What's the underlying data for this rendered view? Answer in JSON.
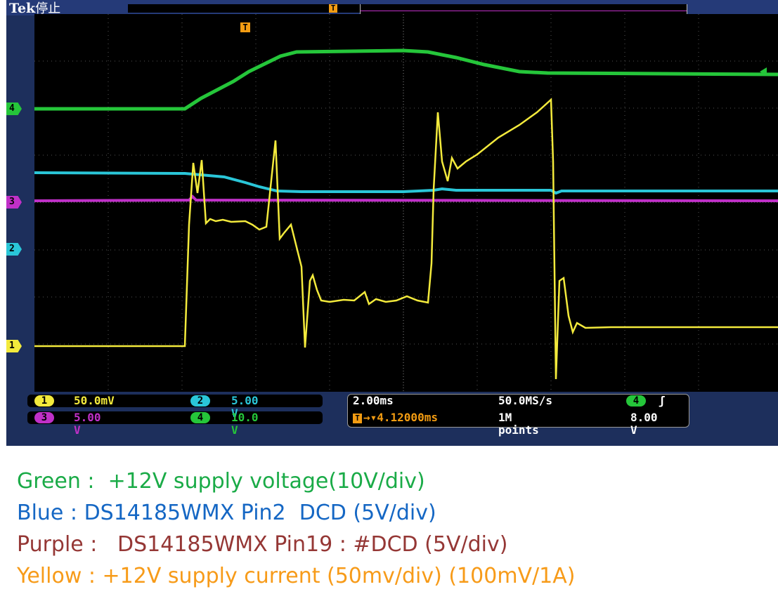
{
  "scope": {
    "brand": "Tek",
    "run_state": "停止",
    "trigger_marker": "T",
    "channel_markers": [
      "4",
      "3",
      "2",
      "1"
    ]
  },
  "channels": {
    "ch1": {
      "number": "1",
      "scale": "50.0mV",
      "color": "#f3ea3c"
    },
    "ch2": {
      "number": "2",
      "scale": "5.00 V",
      "color": "#2ac6d8"
    },
    "ch3": {
      "number": "3",
      "scale": "5.00 V",
      "color": "#c030c8"
    },
    "ch4": {
      "number": "4",
      "scale": "10.0 V",
      "color": "#25c63a"
    }
  },
  "timebase": {
    "time_div": "2.00ms",
    "sample_rate": "50.0MS/s",
    "trigger_delay": "4.12000ms",
    "record_length": "1M points"
  },
  "trigger": {
    "source": "4",
    "slope_symbol": "ʃ",
    "level": "8.00 V"
  },
  "legend": [
    {
      "text": "Green :  +12V supply voltage(10V/div)",
      "color": "#1aab47"
    },
    {
      "text": "Blue : DS14185WMX Pin2  DCD (5V/div)",
      "color": "#1567c4"
    },
    {
      "text": "Purple :   DS14185WMX Pin19 : #DCD (5V/div)",
      "color": "#953735"
    },
    {
      "text": "Yellow : +12V supply current (50mv/div) (100mV/1A)",
      "color": "#f79b19"
    }
  ]
}
